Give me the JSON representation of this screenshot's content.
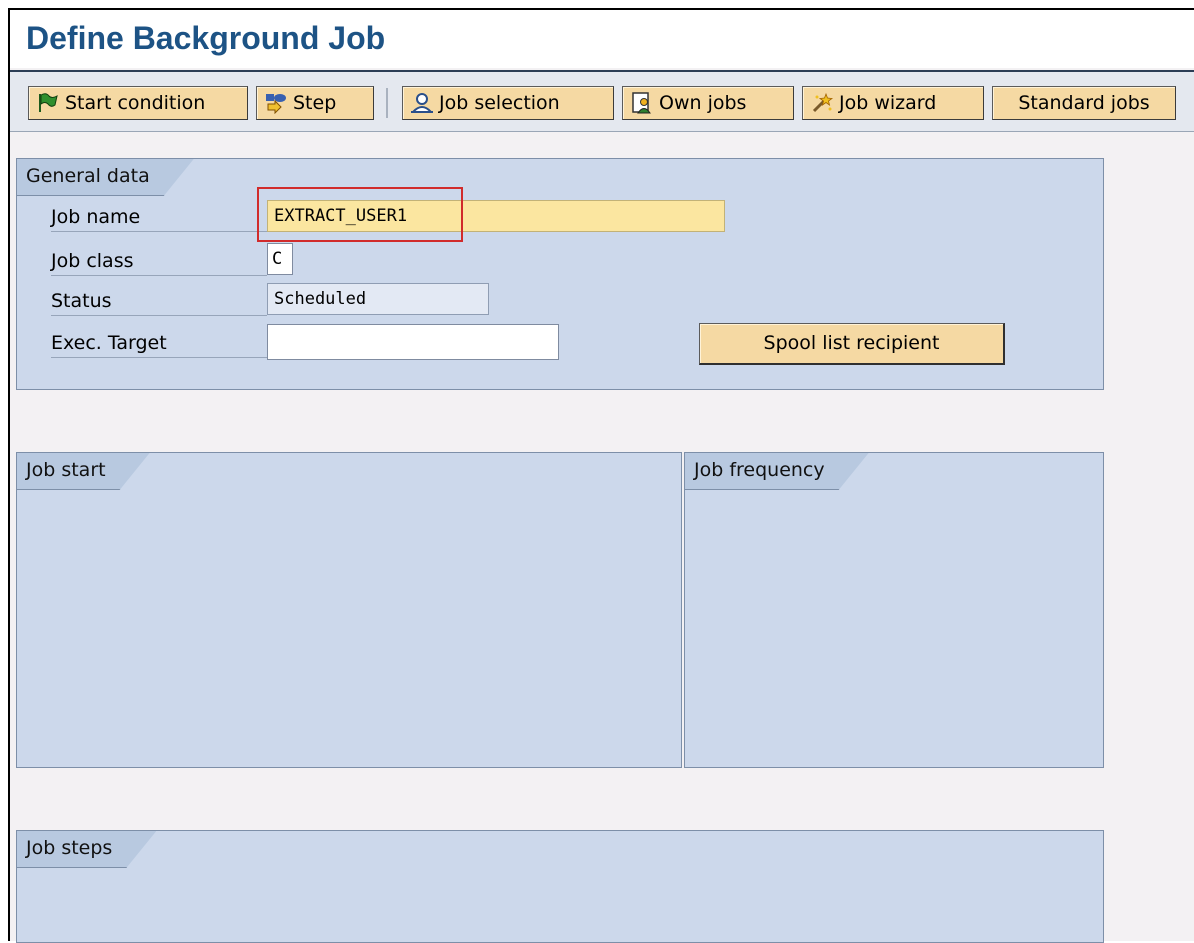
{
  "window": {
    "title": "Define Background Job"
  },
  "toolbar": {
    "buttons": [
      {
        "label": "Start condition",
        "icon": "flag-icon"
      },
      {
        "label": "Step",
        "icon": "step-icon"
      },
      {
        "label": "Job selection",
        "icon": "user-select-icon"
      },
      {
        "label": "Own jobs",
        "icon": "own-jobs-icon"
      },
      {
        "label": "Job wizard",
        "icon": "wizard-icon"
      },
      {
        "label": "Standard jobs",
        "icon": ""
      }
    ]
  },
  "general": {
    "section_title": "General data",
    "job_name_label": "Job name",
    "job_name_value": "EXTRACT_USER1",
    "job_class_label": "Job class",
    "job_class_value": "C",
    "status_label": "Status",
    "status_value": "Scheduled",
    "exec_target_label": "Exec. Target",
    "exec_target_value": "",
    "spool_button": "Spool list recipient"
  },
  "job_start": {
    "section_title": "Job start"
  },
  "job_frequency": {
    "section_title": "Job frequency"
  },
  "job_steps": {
    "section_title": "Job steps"
  },
  "colors": {
    "title": "#1d5385",
    "button": "#f5d9a3",
    "panel": "#ccd8eb",
    "highlight": "#d12b2b",
    "input_required": "#fbe6a0"
  }
}
